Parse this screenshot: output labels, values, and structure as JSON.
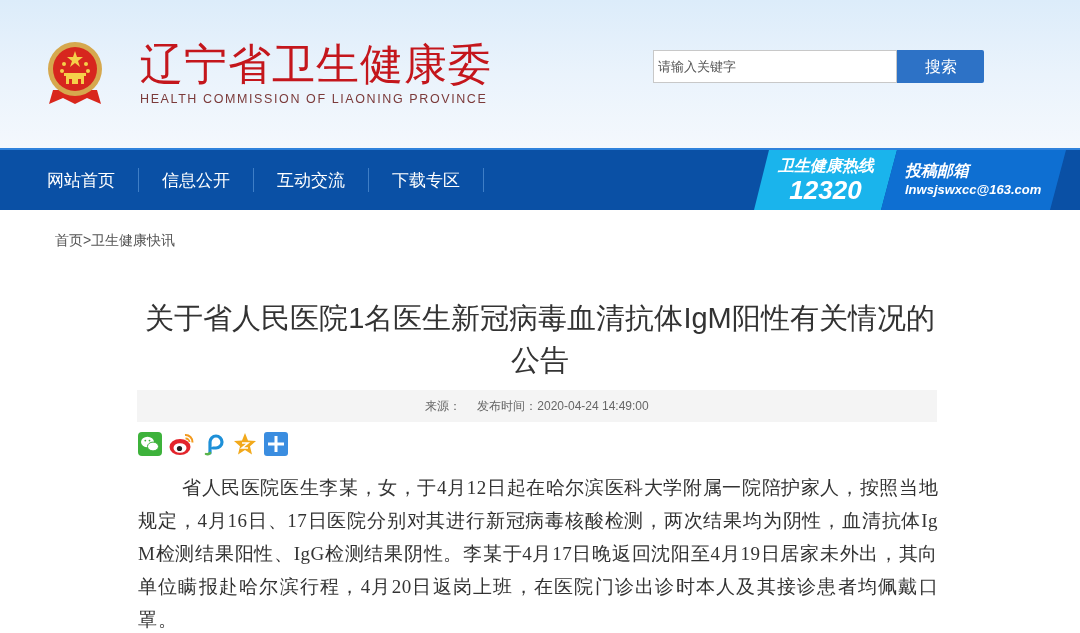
{
  "header": {
    "title": "辽宁省卫生健康委",
    "subtitle": "HEALTH COMMISSION OF LIAONING PROVINCE",
    "search": {
      "placeholder": "请输入关键字",
      "button": "搜索"
    }
  },
  "nav": {
    "items": [
      "网站首页",
      "信息公开",
      "互动交流",
      "下载专区"
    ],
    "hotline": {
      "label": "卫生健康热线",
      "number": "12320"
    },
    "mailbox": {
      "label": "投稿邮箱",
      "email": "lnwsjswxcc@163.com"
    }
  },
  "breadcrumb": {
    "items": [
      "首页",
      "卫生健康快讯"
    ],
    "separator": ">"
  },
  "article": {
    "title": "关于省人民医院1名医生新冠病毒血清抗体IgM阳性有关情况的公告",
    "source_label": "来源：",
    "published": "发布时间：2020-04-24 14:49:00",
    "paragraphs": [
      "省人民医院医生李某，女，于4月12日起在哈尔滨医科大学附属一院陪护家人，按照当地规定，4月16日、17日医院分别对其进行新冠病毒核酸检测，两次结果均为阴性，血清抗体IgM检测结果阳性、IgG检测结果阴性。李某于4月17日晚返回沈阳至4月19日居家未外出，其向单位瞒报赴哈尔滨行程，4月20日返岗上班，在医院门诊出诊时本人及其接诊患者均佩戴口罩。"
    ]
  }
}
